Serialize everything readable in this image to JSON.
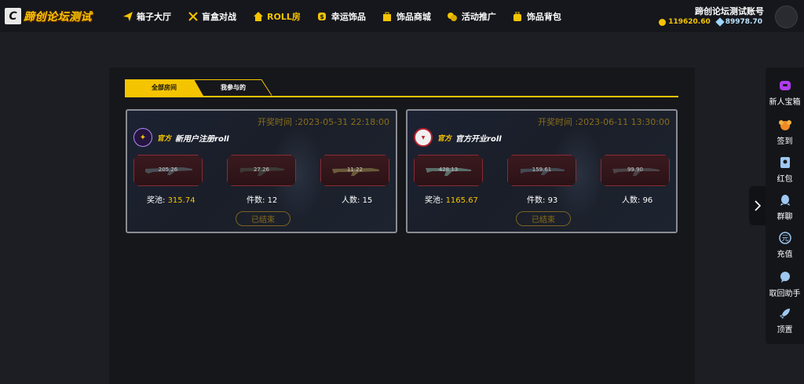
{
  "header": {
    "logo_letter": "C",
    "site_title": "蹄创论坛测试",
    "nav": [
      {
        "label": "箱子大厅",
        "icon": "paper-plane-icon",
        "active": false
      },
      {
        "label": "盲盒对战",
        "icon": "crossed-swords-icon",
        "active": false
      },
      {
        "label": "ROLL房",
        "icon": "house-icon",
        "active": true
      },
      {
        "label": "幸运饰品",
        "icon": "lucky-coin-icon",
        "active": false
      },
      {
        "label": "饰品商城",
        "icon": "shopping-bag-icon",
        "active": false
      },
      {
        "label": "活动推广",
        "icon": "coins-icon",
        "active": false
      },
      {
        "label": "饰品背包",
        "icon": "backpack-icon",
        "active": false
      }
    ],
    "account_name": "蹄创论坛测试账号",
    "coin_balance": "119620.60",
    "diamond_balance": "89978.70"
  },
  "tabs": {
    "all_rooms": "全部房间",
    "joined": "我参与的"
  },
  "rooms": [
    {
      "draw_time": "开奖时间 :2023-05-31 22:18:00",
      "badge": "官方",
      "name": "新用户注册roll",
      "items": [
        {
          "price": "205.26"
        },
        {
          "price": "27.26"
        },
        {
          "price": "11.22"
        }
      ],
      "pool_label": "奖池: ",
      "pool_value": "315.74",
      "count_label": "件数: ",
      "count_value": "12",
      "people_label": "人数: ",
      "people_value": "15",
      "status": "已结束"
    },
    {
      "draw_time": "开奖时间 :2023-06-11 13:30:00",
      "badge": "官方",
      "name": "官方开业roll",
      "items": [
        {
          "price": "428.13"
        },
        {
          "price": "159.61"
        },
        {
          "price": "99.90"
        }
      ],
      "pool_label": "奖池: ",
      "pool_value": "1165.67",
      "count_label": "件数: ",
      "count_value": "93",
      "people_label": "人数: ",
      "people_value": "96",
      "status": "已结束"
    }
  ],
  "sidebar": [
    {
      "label": "新人宝箱",
      "icon": "gift-box-icon"
    },
    {
      "label": "签到",
      "icon": "check-in-icon"
    },
    {
      "label": "红包",
      "icon": "red-packet-icon"
    },
    {
      "label": "群聊",
      "icon": "qq-penguin-icon"
    },
    {
      "label": "充值",
      "icon": "yuan-icon"
    },
    {
      "label": "取回助手",
      "icon": "chat-bubble-icon"
    },
    {
      "label": "顶置",
      "icon": "rocket-icon"
    }
  ],
  "colors": {
    "accent": "#f5c400",
    "background": "#1d1e24",
    "item_border": "#8b2a33"
  }
}
